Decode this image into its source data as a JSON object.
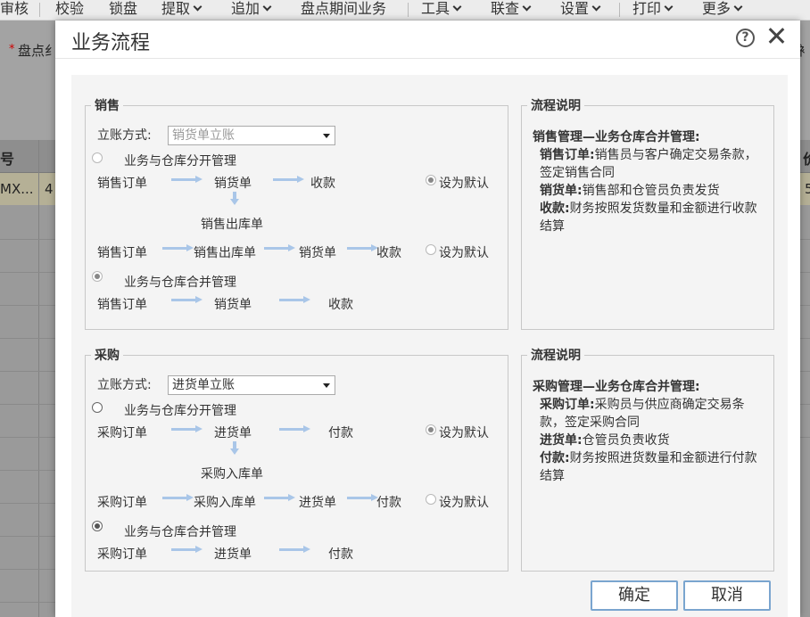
{
  "app_menu": {
    "items": [
      "审核",
      "校验",
      "锁盘",
      "提取",
      "追加",
      "盘点期间业务",
      "工具",
      "联查",
      "设置",
      "打印",
      "更多"
    ]
  },
  "background": {
    "form_label": "盘点纟",
    "right_label": "衤",
    "table_header_left": "号",
    "table_header_right": "价",
    "row_cell_1": "MX...",
    "row_cell_2": "4",
    "row_cell_right": "5"
  },
  "dialog": {
    "title": "业务流程",
    "help_glyph": "?",
    "sales": {
      "legend": "销售",
      "booking_label": "立账方式:",
      "booking_value": "销货单立账",
      "mode_separate": "业务与仓库分开管理",
      "mode_combined": "业务与仓库合并管理",
      "flow1": [
        "销售订单",
        "销货单",
        "收款"
      ],
      "flow1_down": "销售出库单",
      "flow2": [
        "销售订单",
        "销售出库单",
        "销货单",
        "收款"
      ],
      "flow3": [
        "销售订单",
        "销货单",
        "收款"
      ],
      "default_label": "设为默认"
    },
    "sales_desc": {
      "legend": "流程说明",
      "heading": "销售管理—业务仓库合并管理:",
      "item1_key": "销售订单:",
      "item1_text": "销售员与客户确定交易条款，签定销售合同",
      "item2_key": "销货单:",
      "item2_text": "销售部和仓管员负责发货",
      "item3_key": "收款:",
      "item3_text": "财务按照发货数量和金额进行收款结算"
    },
    "purchase": {
      "legend": "采购",
      "booking_label": "立账方式:",
      "booking_value": "进货单立账",
      "mode_separate": "业务与仓库分开管理",
      "mode_combined": "业务与仓库合并管理",
      "flow1": [
        "采购订单",
        "进货单",
        "付款"
      ],
      "flow1_down": "采购入库单",
      "flow2": [
        "采购订单",
        "采购入库单",
        "进货单",
        "付款"
      ],
      "flow3": [
        "采购订单",
        "进货单",
        "付款"
      ],
      "default_label": "设为默认"
    },
    "purchase_desc": {
      "legend": "流程说明",
      "heading": "采购管理—业务仓库合并管理:",
      "item1_key": "采购订单:",
      "item1_text": "采购员与供应商确定交易条款，签定采购合同",
      "item2_key": "进货单:",
      "item2_text": "仓管员负责收货",
      "item3_key": "付款:",
      "item3_text": "财务按照进货数量和金额进行付款结算"
    },
    "ok_label": "确定",
    "cancel_label": "取消"
  }
}
